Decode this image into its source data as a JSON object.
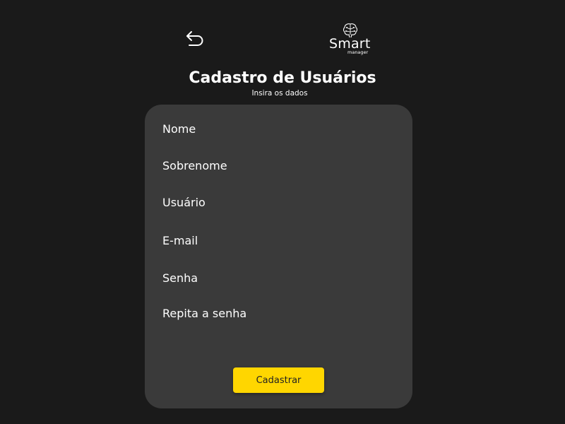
{
  "header": {
    "back_icon": "undo-arrow-icon",
    "logo": {
      "icon": "brain-icon",
      "word": "Smart",
      "sub": "manager"
    }
  },
  "title": "Cadastro de Usuários",
  "subtitle": "Insira os dados",
  "form": {
    "fields": [
      {
        "placeholder": "Nome"
      },
      {
        "placeholder": "Sobrenome"
      },
      {
        "placeholder": "Usuário"
      },
      {
        "placeholder": "E-mail"
      },
      {
        "placeholder": "Senha"
      },
      {
        "placeholder": "Repita a senha"
      }
    ],
    "submit_label": "Cadastrar"
  },
  "colors": {
    "background": "#1a1a1a",
    "card": "#3a3a3a",
    "accent": "#ffd600",
    "text": "#ffffff"
  }
}
